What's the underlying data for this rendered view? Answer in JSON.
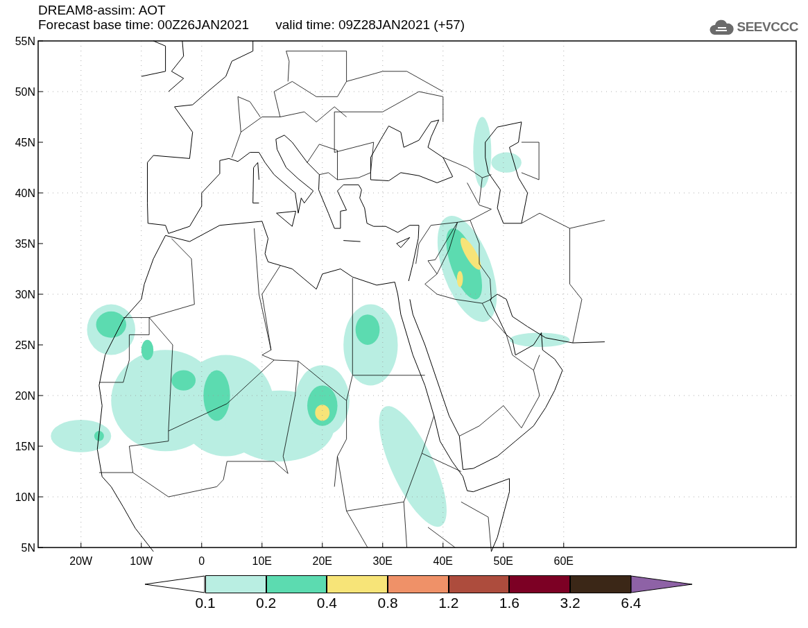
{
  "header": {
    "title": "DREAM8-assim: AOT",
    "base_time": "Forecast base time: 00Z26JAN2021",
    "valid_time": "valid time: 09Z28JAN2021 (+57)"
  },
  "logo": {
    "text": "SEEVCCC"
  },
  "map": {
    "lat_labels": [
      "55N",
      "50N",
      "45N",
      "40N",
      "35N",
      "30N",
      "25N",
      "20N",
      "15N",
      "10N",
      "5N"
    ],
    "lon_labels": [
      "20W",
      "10W",
      "0",
      "10E",
      "20E",
      "30E",
      "40E",
      "50E",
      "60E"
    ]
  },
  "colorbar": {
    "bins": [
      {
        "color": "#ffffff"
      },
      {
        "color": "#b9eee2"
      },
      {
        "color": "#5cdbb0"
      },
      {
        "color": "#f7e478"
      },
      {
        "color": "#ef9168"
      },
      {
        "color": "#ad4c3d"
      },
      {
        "color": "#7c0024"
      },
      {
        "color": "#3b2717"
      },
      {
        "color": "#8e62a6"
      }
    ],
    "labels": [
      "0.1",
      "0.2",
      "0.4",
      "0.8",
      "1.2",
      "1.6",
      "3.2",
      "6.4"
    ]
  }
}
